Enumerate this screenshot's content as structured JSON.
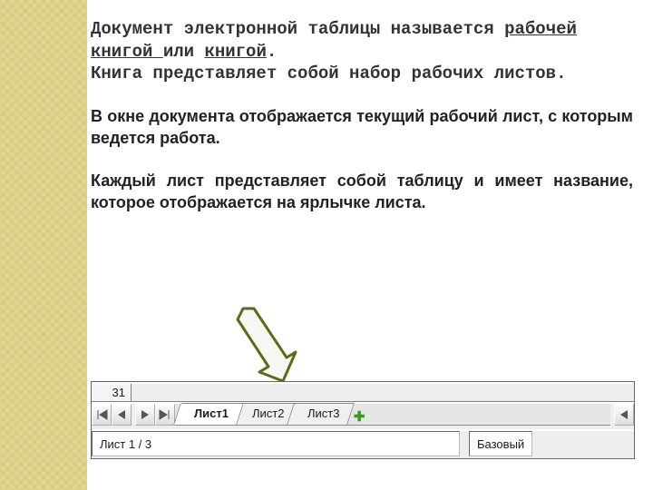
{
  "paragraphs": {
    "p1_a": "Документ электронной таблицы  называется ",
    "p1_u1": "рабочей книгой ",
    "p1_b": "или ",
    "p1_u2": "книгой",
    "p1_c": ".",
    "p1_d": "Книга представляет собой набор рабочих листов.",
    "p2": "В окне документа отображается текущий рабочий лист, с которым ведется работа.",
    "p3": "Каждый лист представляет собой таблицу и имеет название, которое отображается на ярлычке листа."
  },
  "sheet": {
    "row_number": "31",
    "tabs": [
      "Лист1",
      "Лист2",
      "Лист3"
    ],
    "active_tab": 0,
    "plus": "✚",
    "nav_glyphs": {
      "first": "▮◀",
      "prev": "◀",
      "next": "▶",
      "last": "▶▮"
    },
    "status_left": "Лист 1 / 3",
    "status_right": "Базовый"
  }
}
